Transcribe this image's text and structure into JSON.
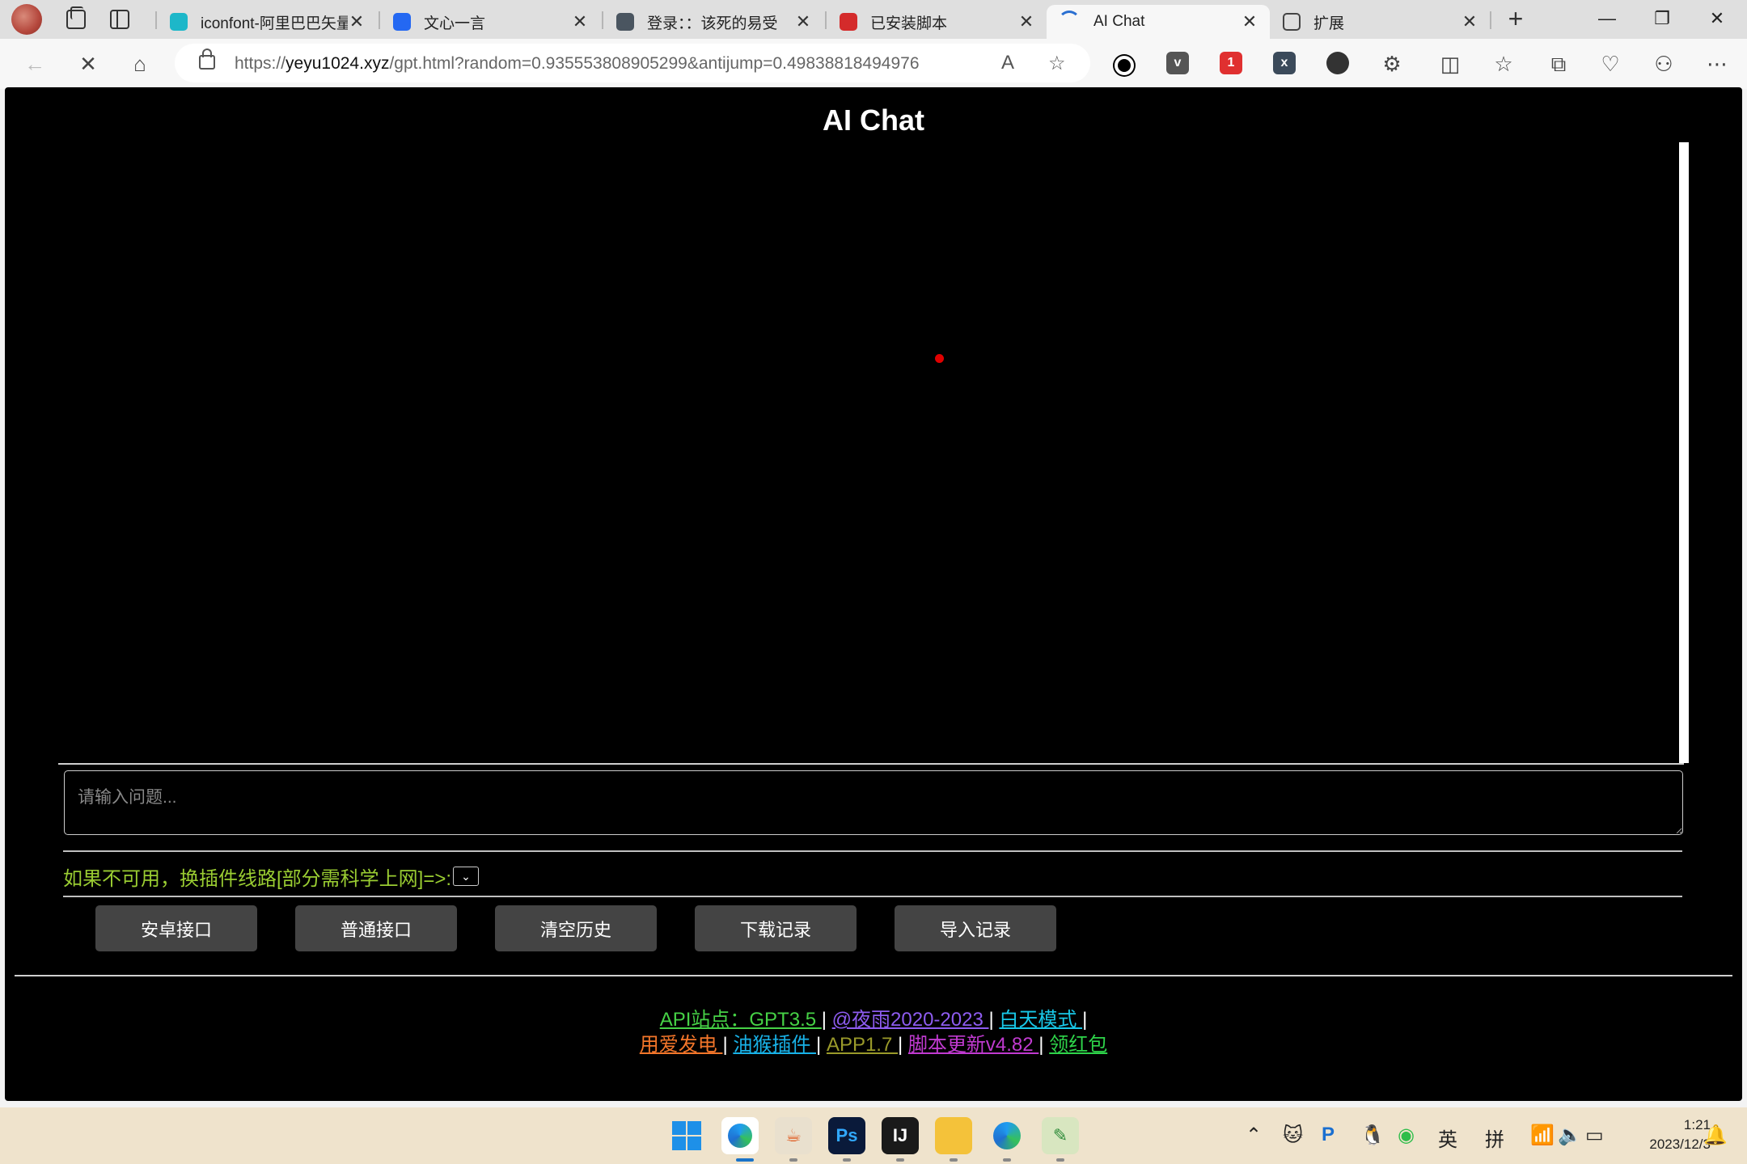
{
  "browser": {
    "tabs": [
      {
        "title": "iconfont-阿里巴巴矢量",
        "close": "✕"
      },
      {
        "title": "文心一言",
        "close": "✕"
      },
      {
        "title": "登录：：该死的易受",
        "close": "✕"
      },
      {
        "title": "已安装脚本",
        "close": "✕"
      },
      {
        "title": "AI Chat",
        "close": "✕"
      },
      {
        "title": "扩展",
        "close": "✕"
      }
    ],
    "new_tab": "+",
    "url_prefix": "https://",
    "url_host": "yeyu1024.xyz",
    "url_path": "/gpt.html?random=0.935553808905299&antijump=0.49838818494976"
  },
  "page": {
    "title": "AI Chat",
    "input_placeholder": "请输入问题...",
    "route_label": "如果不可用，换插件线路[部分需科学上网]=>:",
    "route_select": "⌄",
    "buttons": [
      "安卓接口",
      "普通接口",
      "清空历史",
      "下载记录",
      "导入记录"
    ],
    "footer_line1": [
      {
        "text": "API站点：GPT3.5 ",
        "color": "#46d246"
      },
      {
        "text": "@夜雨2020-2023 ",
        "color": "#8e5cf0"
      },
      {
        "text": "白天模式 ",
        "color": "#18c8e8"
      }
    ],
    "footer_line2": [
      {
        "text": "用爱发电 ",
        "color": "#f4762a"
      },
      {
        "text": "油猴插件 ",
        "color": "#18b2e8"
      },
      {
        "text": "APP1.7 ",
        "color": "#9a9a2a"
      },
      {
        "text": "脚本更新v4.82 ",
        "color": "#c03ad0"
      },
      {
        "text": "领红包",
        "color": "#2ed44a"
      }
    ],
    "separator": "|"
  },
  "taskbar": {
    "ime_lang": "英",
    "ime_mode": "拼",
    "time": "1:21",
    "date": "2023/12/3"
  }
}
